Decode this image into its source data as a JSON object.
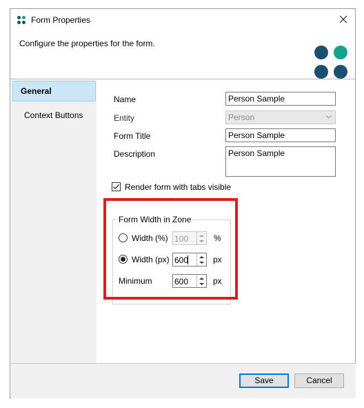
{
  "window": {
    "title": "Form Properties",
    "close_icon": "close-icon"
  },
  "header": {
    "description": "Configure the properties for the form.",
    "logo_colors": [
      "#1b4f72",
      "#17a38b",
      "#1b4f72",
      "#1b4f72"
    ]
  },
  "sidebar": {
    "items": [
      {
        "label": "General",
        "active": true
      },
      {
        "label": "Context Buttons",
        "active": false
      }
    ]
  },
  "form": {
    "name_label": "Name",
    "name_value": "Person Sample",
    "entity_label": "Entity",
    "entity_value": "Person",
    "form_title_label": "Form Title",
    "form_title_value": "Person Sample",
    "description_label": "Description",
    "description_value": "Person Sample",
    "render_tabs_label": "Render form with tabs visible",
    "render_tabs_checked": true
  },
  "width_group": {
    "title": "Form Width in Zone",
    "width_percent_label": "Width (%)",
    "width_percent_value": "100",
    "width_percent_unit": "%",
    "width_px_label": "Width (px)",
    "width_px_value": "600",
    "width_px_unit": "px",
    "minimum_label": "Minimum",
    "minimum_value": "600",
    "minimum_unit": "px",
    "selected": "px"
  },
  "footer": {
    "save_label": "Save",
    "cancel_label": "Cancel"
  },
  "colors": {
    "highlight": "#e01b24",
    "accent": "#0078d7"
  }
}
